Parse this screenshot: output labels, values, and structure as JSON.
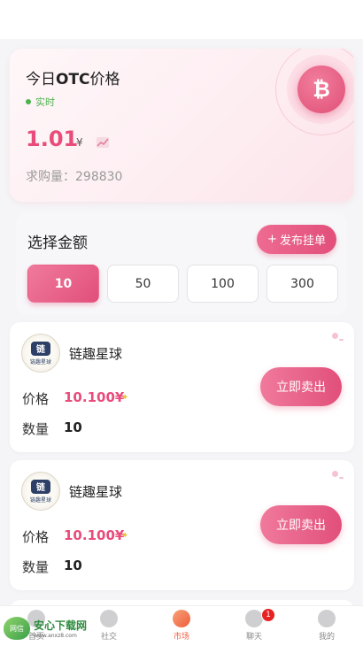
{
  "price_card": {
    "title_prefix": "今日",
    "title_bold": "OTC",
    "title_suffix": "价格",
    "live_label": "实时",
    "price": "1.01",
    "currency": "¥",
    "demand": "求购量：298830",
    "coin_symbol": "₿"
  },
  "amount": {
    "label": "选择金额",
    "publish_button": "发布挂单",
    "publish_plus": "+",
    "options": [
      "10",
      "50",
      "100",
      "300"
    ],
    "selected": "10"
  },
  "listings": [
    {
      "name": "链趣星球",
      "logo_mark": "链",
      "logo_sub": "链趣星球",
      "price_label": "价格",
      "price": "10.100¥",
      "qty_label": "数量",
      "qty": "10",
      "action": "立即卖出"
    },
    {
      "name": "链趣星球",
      "logo_mark": "链",
      "logo_sub": "链趣星球",
      "price_label": "价格",
      "price": "10.100¥",
      "qty_label": "数量",
      "qty": "10",
      "action": "立即卖出"
    }
  ],
  "tabbar": {
    "tabs": [
      {
        "label": "首页"
      },
      {
        "label": "社交"
      },
      {
        "label": "市场"
      },
      {
        "label": "聊天",
        "badge": "1"
      },
      {
        "label": "我的"
      }
    ],
    "active": "市场"
  },
  "watermark": {
    "logo": "网信",
    "main": "安心下载网",
    "url": "www.anxz8.com"
  },
  "colors": {
    "accent": "#e94b7a",
    "live": "#4cb34c",
    "active_tab": "#ef5d3c",
    "badge": "#e62222"
  }
}
